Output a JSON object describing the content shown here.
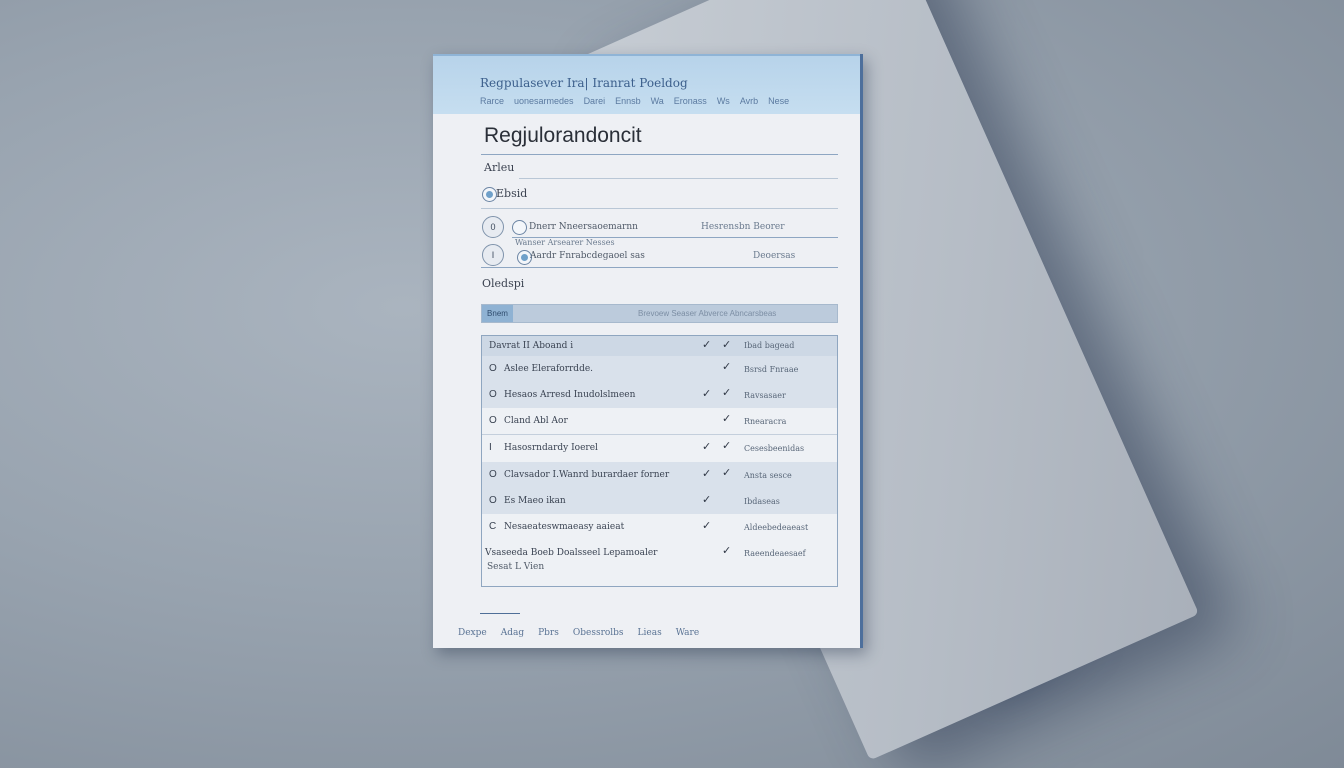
{
  "header": {
    "title": "Regpulasever Ira| Iranrat Poeldog",
    "nav": [
      "Rarce",
      "uonesarmedes",
      "Darei",
      "Ennsb",
      "Wa",
      "Eronass",
      "Ws",
      "Avrb",
      "Nese"
    ]
  },
  "doc": {
    "title": "Regjulorandoncit",
    "field1_label": "Arleu",
    "field2_label": "Ebsid",
    "option1_label": "Dnerr Nneersaoemarnn",
    "option1_value": "Hesrensbn Beorer",
    "option1_sub": "Wanser Arsearer Nesses",
    "option2_label": "Aardr Fnrabcdegaoel sas",
    "option2_value": "Deoersas",
    "circle1": "0",
    "circle2": "I",
    "section_label": "Oledspi",
    "bar_tag": "Bnem",
    "bar_text": "Brevoew Seaser Abverce Abncarsbeas"
  },
  "table": {
    "header": {
      "name": "Davrat II Aboand i",
      "check": "✓",
      "check2": "✓",
      "val": "Ibad bagead"
    },
    "rows": [
      {
        "icon": "O",
        "name": "Aslee Eleraforrdde.",
        "check": "",
        "check2": "✓",
        "val": "Bsrsd Fnraae"
      },
      {
        "icon": "O",
        "name": "Hesaos Arresd Inudolslmeen",
        "check": "✓",
        "check2": "✓",
        "val": "Ravsasaer"
      },
      {
        "icon": "O",
        "name": "Cland Abl Aor",
        "check": "",
        "check2": "✓",
        "val": "Rnearacra"
      },
      {
        "icon": "I",
        "name": "Hasosrndardy Ioerel",
        "check": "✓",
        "check2": "✓",
        "val": "Cesesbeenidas"
      },
      {
        "icon": "O",
        "name": "Clavsador I.Wanrd burardaer forner",
        "check": "✓",
        "check2": "✓",
        "val": "Ansta sesce"
      },
      {
        "icon": "O",
        "name": "Es Maeo ikan",
        "check": "✓",
        "check2": "",
        "val": "Ibdaseas"
      },
      {
        "icon": "C",
        "name": "Nesaeateswmaeasy aaieat",
        "check": "✓",
        "check2": "",
        "val": "Aldeebedeaeast"
      },
      {
        "icon": "",
        "name": "Vsaseeda Boeb Doalsseel Lepamoaler",
        "check": "",
        "check2": "✓",
        "val": "Raeendeaesaef"
      }
    ],
    "trailing": "Sesat L Vien"
  },
  "footer": {
    "links": [
      "Dexpe",
      "Adag",
      "Pbrs",
      "Obessrolbs",
      "Lieas",
      "Ware"
    ]
  }
}
